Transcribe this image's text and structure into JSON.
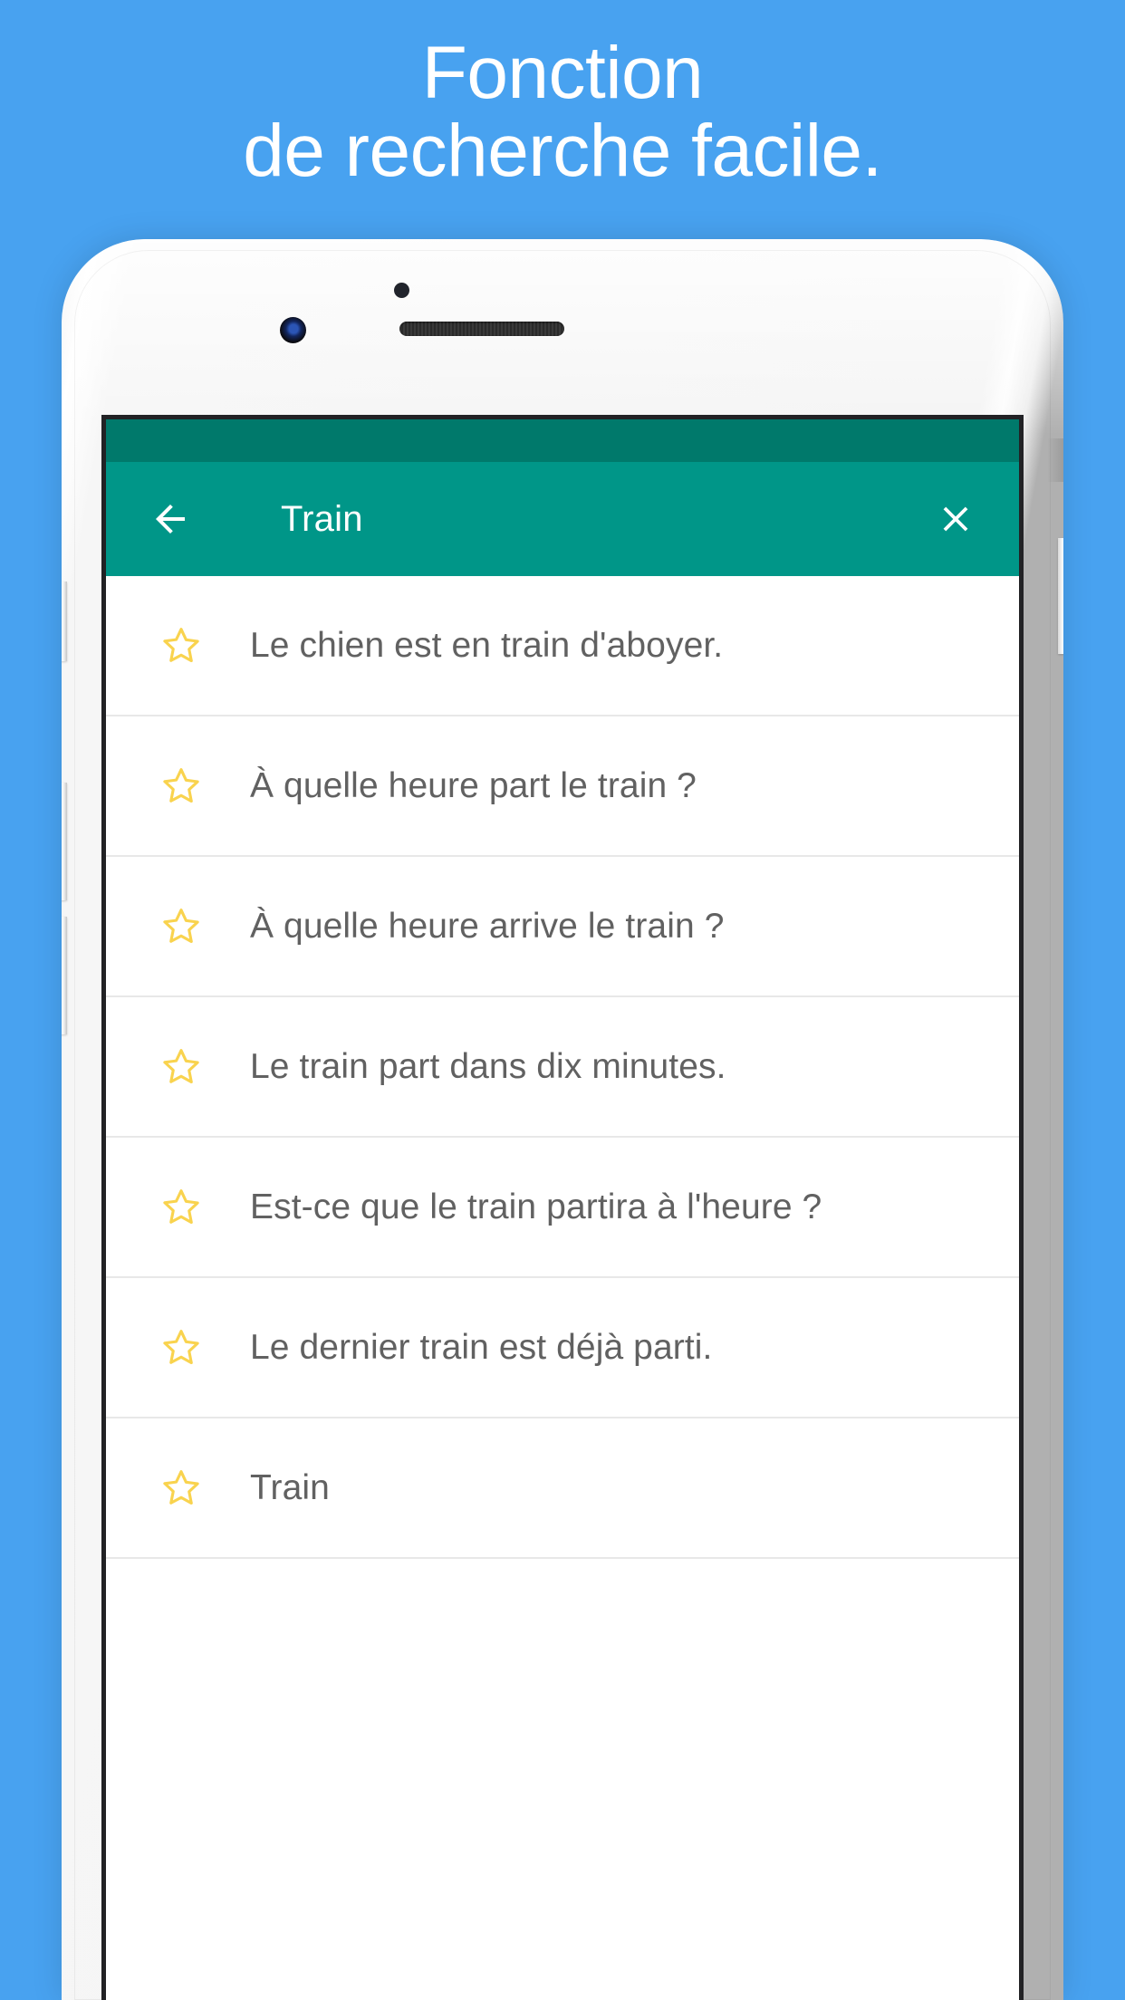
{
  "promo": {
    "headline_lines": [
      "Fonction",
      "de recherche facile."
    ],
    "background_color": "#48a2f0",
    "headline_color": "#ffffff"
  },
  "device": {
    "frame_color": "#f4f4f4",
    "hardware": {
      "earpiece_speaker": "speaker-grille",
      "front_camera": "camera-lens",
      "proximity_sensor": "sensor-dot",
      "silent_switch": "silent-switch-button",
      "volume_up": "volume-up-button",
      "volume_down": "volume-down-button",
      "power": "power-button"
    }
  },
  "app": {
    "status_bar_color": "#00796b",
    "toolbar": {
      "color": "#009688",
      "back_icon": "arrow-left-icon",
      "title": "Train",
      "close_icon": "close-icon",
      "title_color": "#ffffff"
    },
    "list": {
      "star_color": "#f9d34e",
      "text_color": "#616161",
      "divider_color": "#e8e8e8",
      "items": [
        {
          "star_icon": "star-outline-icon",
          "text": "Le chien est en train d'aboyer."
        },
        {
          "star_icon": "star-outline-icon",
          "text": "À quelle heure part le train ?"
        },
        {
          "star_icon": "star-outline-icon",
          "text": "À quelle heure arrive le train ?"
        },
        {
          "star_icon": "star-outline-icon",
          "text": "Le train part dans dix minutes."
        },
        {
          "star_icon": "star-outline-icon",
          "text": "Est-ce que le train partira à l'heure ?"
        },
        {
          "star_icon": "star-outline-icon",
          "text": "Le dernier train est déjà parti."
        },
        {
          "star_icon": "star-outline-icon",
          "text": "Train"
        }
      ]
    }
  }
}
